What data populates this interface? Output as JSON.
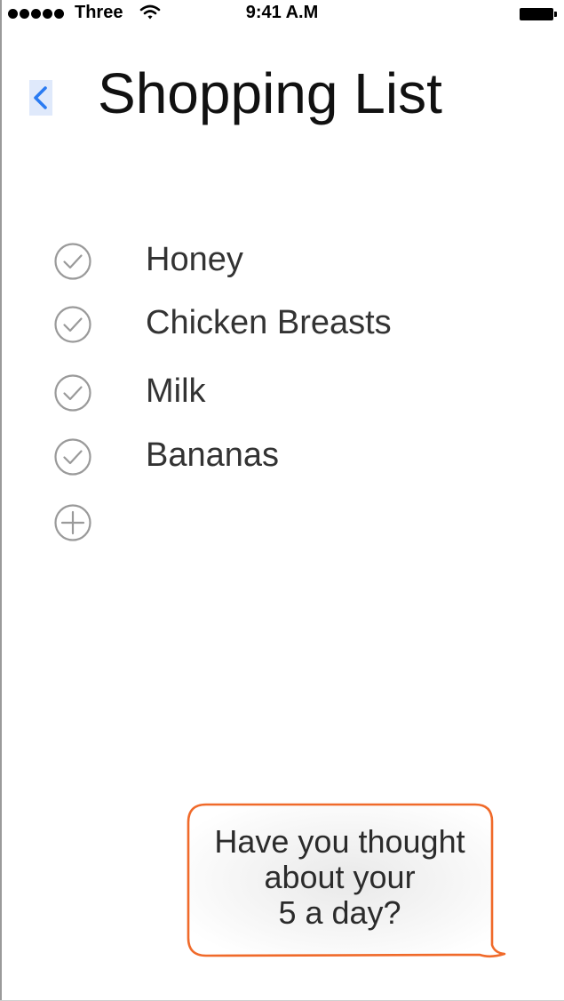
{
  "status_bar": {
    "carrier": "Three",
    "time": "9:41 A.M",
    "signal_icon": "signal-dots-icon",
    "wifi_icon": "wifi-icon",
    "battery_icon": "battery-icon"
  },
  "header": {
    "title": "Shopping List",
    "back_icon": "chevron-left-icon"
  },
  "list": {
    "items": [
      {
        "label": "Honey",
        "icon": "check-circle-icon"
      },
      {
        "label": "Chicken Breasts",
        "icon": "check-circle-icon"
      },
      {
        "label": "Milk",
        "icon": "check-circle-icon"
      },
      {
        "label": "Bananas",
        "icon": "check-circle-icon"
      }
    ],
    "add_icon": "plus-circle-icon"
  },
  "bubble": {
    "text": "Have you thought\nabout your\n5 a day?"
  },
  "colors": {
    "accent_blue": "#2a7bf2",
    "bubble_border": "#f06a2a",
    "icon_gray": "#9a9a9a"
  }
}
